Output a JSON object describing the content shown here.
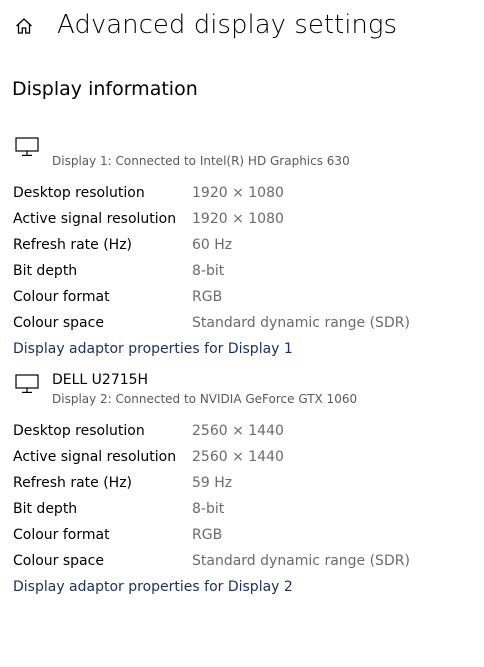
{
  "header": {
    "title": "Advanced display settings",
    "home_icon": "home-icon"
  },
  "section": {
    "title": "Display information"
  },
  "displays": [
    {
      "name": "",
      "subtitle": "Display 1: Connected to Intel(R) HD Graphics 630",
      "icon": "monitor-icon",
      "rows": [
        {
          "label": "Desktop resolution",
          "value": "1920 × 1080"
        },
        {
          "label": "Active signal resolution",
          "value": "1920 × 1080"
        },
        {
          "label": "Refresh rate (Hz)",
          "value": "60 Hz"
        },
        {
          "label": "Bit depth",
          "value": "8-bit"
        },
        {
          "label": "Colour format",
          "value": "RGB"
        },
        {
          "label": "Colour space",
          "value": "Standard dynamic range (SDR)"
        }
      ],
      "link": "Display adaptor properties for Display 1"
    },
    {
      "name": "DELL U2715H",
      "subtitle": "Display 2: Connected to NVIDIA GeForce GTX 1060",
      "icon": "monitor-icon",
      "rows": [
        {
          "label": "Desktop resolution",
          "value": "2560 × 1440"
        },
        {
          "label": "Active signal resolution",
          "value": "2560 × 1440"
        },
        {
          "label": "Refresh rate (Hz)",
          "value": "59 Hz"
        },
        {
          "label": "Bit depth",
          "value": "8-bit"
        },
        {
          "label": "Colour format",
          "value": "RGB"
        },
        {
          "label": "Colour space",
          "value": "Standard dynamic range (SDR)"
        }
      ],
      "link": "Display adaptor properties for Display 2"
    }
  ],
  "colors": {
    "link": "#1d2f5e",
    "value_text": "#6b6b6b",
    "subtitle_text": "#5a5a5a"
  }
}
